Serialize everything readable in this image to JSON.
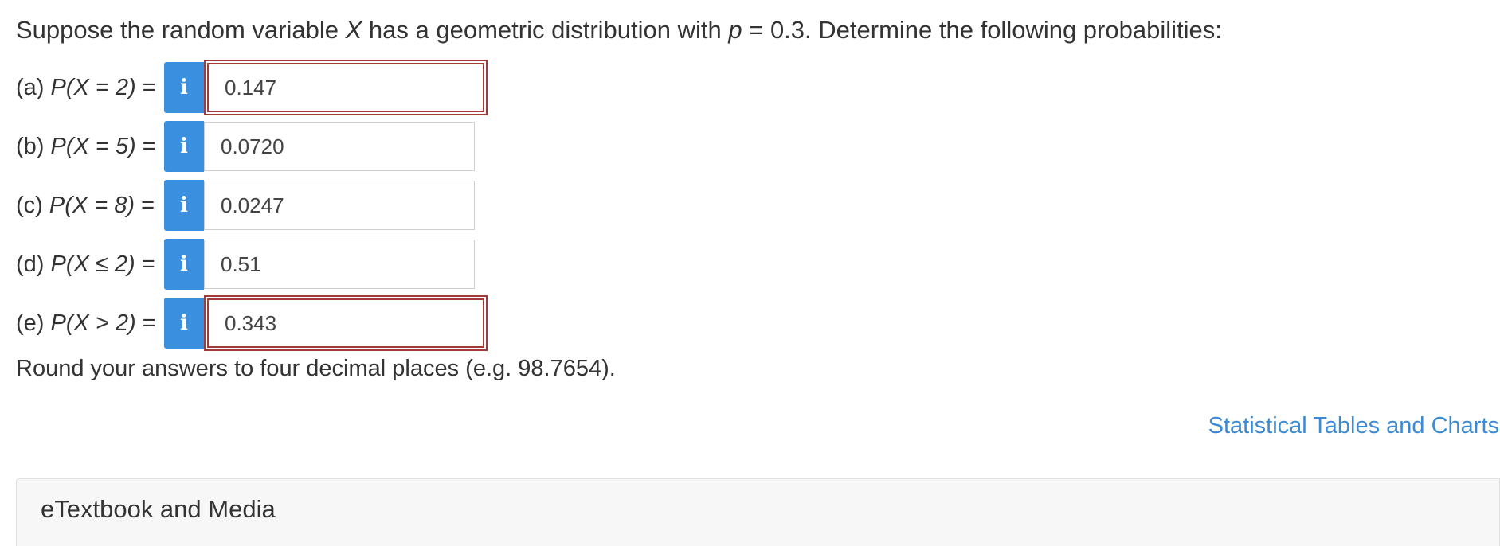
{
  "question": {
    "prefix": "Suppose the random variable ",
    "var": "X",
    "middle": " has a geometric distribution with ",
    "param": "p",
    "suffix": " = 0.3. Determine the following probabilities:"
  },
  "parts": [
    {
      "letter": "(a) ",
      "expr": "P(X = 2)",
      "eq": " =",
      "answer": "0.147",
      "status": "incorrect"
    },
    {
      "letter": "(b) ",
      "expr": "P(X = 5)",
      "eq": " =",
      "answer": "0.0720",
      "status": "neutral"
    },
    {
      "letter": "(c) ",
      "expr": "P(X = 8)",
      "eq": " =",
      "answer": "0.0247",
      "status": "neutral"
    },
    {
      "letter": "(d) ",
      "expr": "P(X ≤ 2)",
      "eq": " =",
      "answer": "0.51",
      "status": "neutral"
    },
    {
      "letter": "(e) ",
      "expr": "P(X > 2)",
      "eq": " =",
      "answer": "0.343",
      "status": "incorrect"
    }
  ],
  "info_glyph": "i",
  "round_note": "Round your answers to four decimal places (e.g. 98.7654).",
  "tables_link": "Statistical Tables and Charts",
  "etextbook": {
    "title": "eTextbook and Media"
  },
  "colors": {
    "info_button": "#3a8fde",
    "incorrect_border": "#a33a3a",
    "link": "#3b8bd4"
  },
  "icons": {
    "info": "info-icon"
  }
}
